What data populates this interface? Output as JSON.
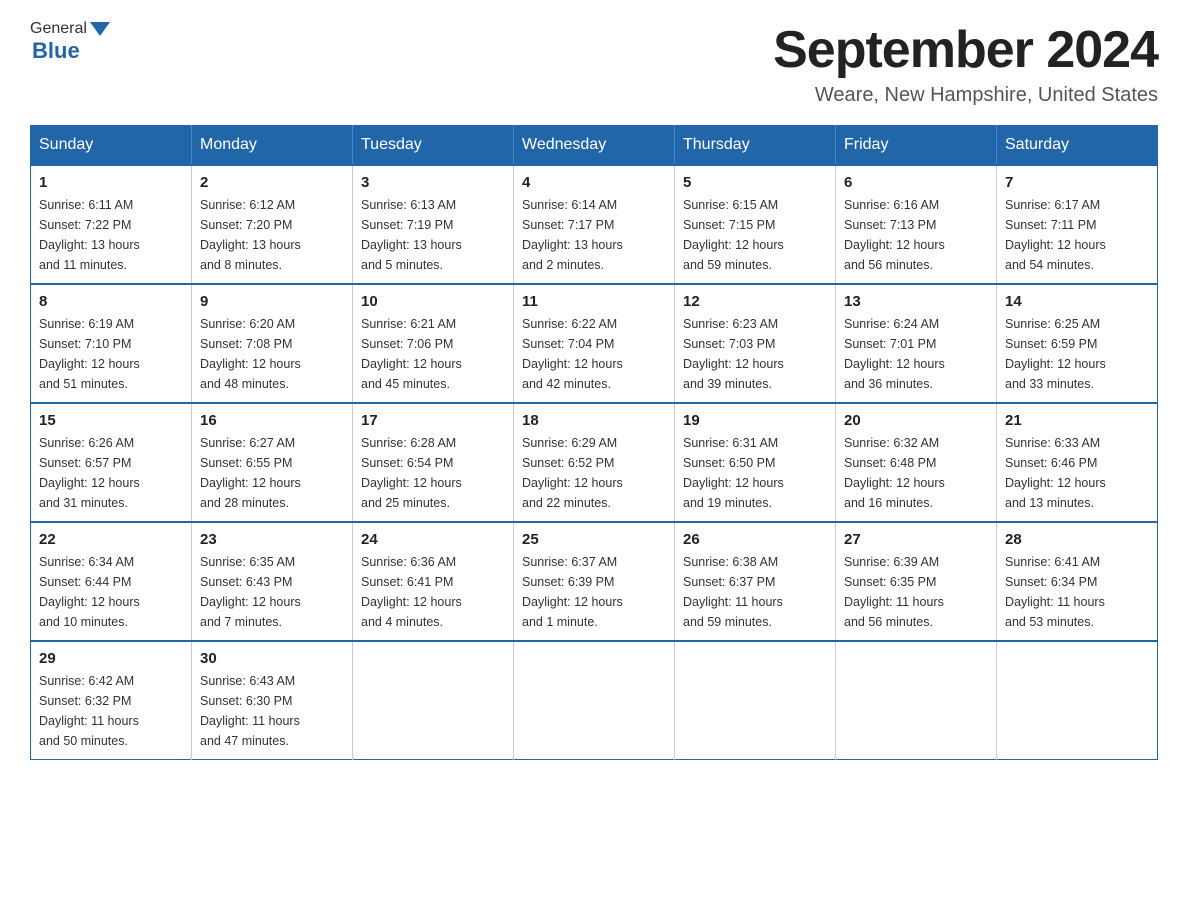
{
  "header": {
    "logo_general": "General",
    "logo_blue": "Blue",
    "month_title": "September 2024",
    "location": "Weare, New Hampshire, United States"
  },
  "calendar": {
    "days_of_week": [
      "Sunday",
      "Monday",
      "Tuesday",
      "Wednesday",
      "Thursday",
      "Friday",
      "Saturday"
    ],
    "weeks": [
      [
        {
          "day": "1",
          "sunrise": "6:11 AM",
          "sunset": "7:22 PM",
          "daylight": "13 hours and 11 minutes."
        },
        {
          "day": "2",
          "sunrise": "6:12 AM",
          "sunset": "7:20 PM",
          "daylight": "13 hours and 8 minutes."
        },
        {
          "day": "3",
          "sunrise": "6:13 AM",
          "sunset": "7:19 PM",
          "daylight": "13 hours and 5 minutes."
        },
        {
          "day": "4",
          "sunrise": "6:14 AM",
          "sunset": "7:17 PM",
          "daylight": "13 hours and 2 minutes."
        },
        {
          "day": "5",
          "sunrise": "6:15 AM",
          "sunset": "7:15 PM",
          "daylight": "12 hours and 59 minutes."
        },
        {
          "day": "6",
          "sunrise": "6:16 AM",
          "sunset": "7:13 PM",
          "daylight": "12 hours and 56 minutes."
        },
        {
          "day": "7",
          "sunrise": "6:17 AM",
          "sunset": "7:11 PM",
          "daylight": "12 hours and 54 minutes."
        }
      ],
      [
        {
          "day": "8",
          "sunrise": "6:19 AM",
          "sunset": "7:10 PM",
          "daylight": "12 hours and 51 minutes."
        },
        {
          "day": "9",
          "sunrise": "6:20 AM",
          "sunset": "7:08 PM",
          "daylight": "12 hours and 48 minutes."
        },
        {
          "day": "10",
          "sunrise": "6:21 AM",
          "sunset": "7:06 PM",
          "daylight": "12 hours and 45 minutes."
        },
        {
          "day": "11",
          "sunrise": "6:22 AM",
          "sunset": "7:04 PM",
          "daylight": "12 hours and 42 minutes."
        },
        {
          "day": "12",
          "sunrise": "6:23 AM",
          "sunset": "7:03 PM",
          "daylight": "12 hours and 39 minutes."
        },
        {
          "day": "13",
          "sunrise": "6:24 AM",
          "sunset": "7:01 PM",
          "daylight": "12 hours and 36 minutes."
        },
        {
          "day": "14",
          "sunrise": "6:25 AM",
          "sunset": "6:59 PM",
          "daylight": "12 hours and 33 minutes."
        }
      ],
      [
        {
          "day": "15",
          "sunrise": "6:26 AM",
          "sunset": "6:57 PM",
          "daylight": "12 hours and 31 minutes."
        },
        {
          "day": "16",
          "sunrise": "6:27 AM",
          "sunset": "6:55 PM",
          "daylight": "12 hours and 28 minutes."
        },
        {
          "day": "17",
          "sunrise": "6:28 AM",
          "sunset": "6:54 PM",
          "daylight": "12 hours and 25 minutes."
        },
        {
          "day": "18",
          "sunrise": "6:29 AM",
          "sunset": "6:52 PM",
          "daylight": "12 hours and 22 minutes."
        },
        {
          "day": "19",
          "sunrise": "6:31 AM",
          "sunset": "6:50 PM",
          "daylight": "12 hours and 19 minutes."
        },
        {
          "day": "20",
          "sunrise": "6:32 AM",
          "sunset": "6:48 PM",
          "daylight": "12 hours and 16 minutes."
        },
        {
          "day": "21",
          "sunrise": "6:33 AM",
          "sunset": "6:46 PM",
          "daylight": "12 hours and 13 minutes."
        }
      ],
      [
        {
          "day": "22",
          "sunrise": "6:34 AM",
          "sunset": "6:44 PM",
          "daylight": "12 hours and 10 minutes."
        },
        {
          "day": "23",
          "sunrise": "6:35 AM",
          "sunset": "6:43 PM",
          "daylight": "12 hours and 7 minutes."
        },
        {
          "day": "24",
          "sunrise": "6:36 AM",
          "sunset": "6:41 PM",
          "daylight": "12 hours and 4 minutes."
        },
        {
          "day": "25",
          "sunrise": "6:37 AM",
          "sunset": "6:39 PM",
          "daylight": "12 hours and 1 minute."
        },
        {
          "day": "26",
          "sunrise": "6:38 AM",
          "sunset": "6:37 PM",
          "daylight": "11 hours and 59 minutes."
        },
        {
          "day": "27",
          "sunrise": "6:39 AM",
          "sunset": "6:35 PM",
          "daylight": "11 hours and 56 minutes."
        },
        {
          "day": "28",
          "sunrise": "6:41 AM",
          "sunset": "6:34 PM",
          "daylight": "11 hours and 53 minutes."
        }
      ],
      [
        {
          "day": "29",
          "sunrise": "6:42 AM",
          "sunset": "6:32 PM",
          "daylight": "11 hours and 50 minutes."
        },
        {
          "day": "30",
          "sunrise": "6:43 AM",
          "sunset": "6:30 PM",
          "daylight": "11 hours and 47 minutes."
        },
        null,
        null,
        null,
        null,
        null
      ]
    ],
    "labels": {
      "sunrise": "Sunrise:",
      "sunset": "Sunset:",
      "daylight": "Daylight:"
    }
  }
}
